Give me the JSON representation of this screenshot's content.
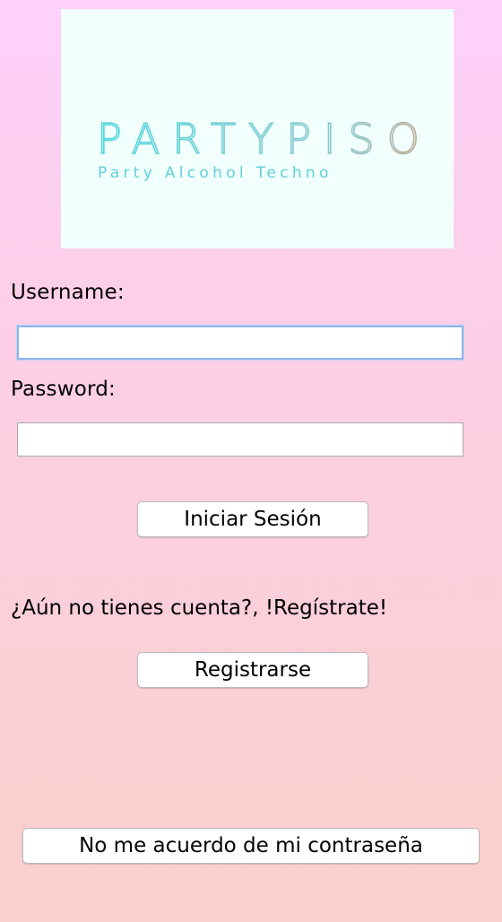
{
  "logo": {
    "brand": "PARTYPISO",
    "tagline": "Party Alcohol Techno"
  },
  "form": {
    "username_label": "Username:",
    "username_value": "",
    "password_label": "Password:",
    "password_value": "",
    "login_button": "Iniciar Sesión"
  },
  "register": {
    "prompt": "¿Aún no tienes cuenta?, !Regístrate!",
    "button": "Registrarse"
  },
  "forgot": {
    "button": "No me acuerdo de mi contraseña"
  },
  "colors": {
    "logo_cyan": "#4fd6df",
    "logo_bg": "#f1fffd",
    "logo_tan": "#c9a98c"
  }
}
